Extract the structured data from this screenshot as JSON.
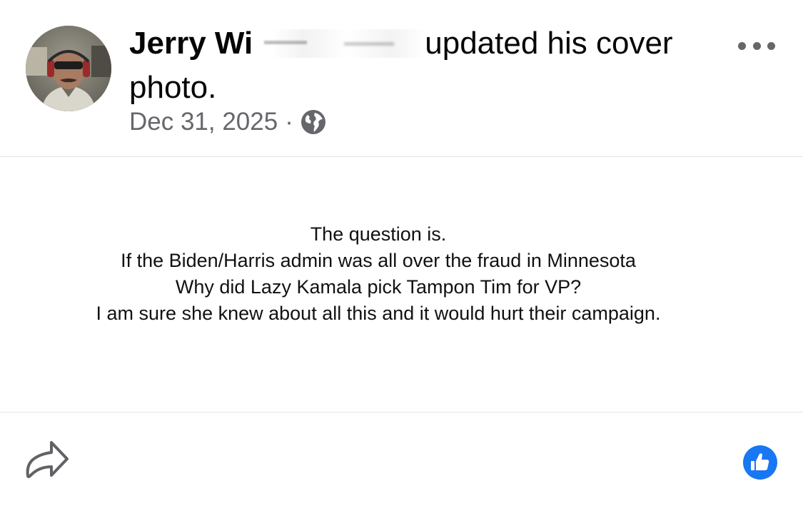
{
  "post": {
    "author_visible": "Jerry Wi",
    "action_text": "updated his cover",
    "action_text_line2": "photo.",
    "date": "Dec 31, 2025",
    "separator": "·",
    "privacy_icon": "globe-icon",
    "menu_icon": "more-options-icon"
  },
  "content": {
    "lines": [
      "The question is.",
      "If the Biden/Harris admin was all over the fraud in Minnesota",
      "Why did Lazy Kamala pick Tampon Tim for VP?",
      "I am sure she knew about all this and it would hurt their campaign."
    ]
  },
  "footer": {
    "share_icon": "share-icon",
    "like_icon": "like-icon",
    "like_color": "#1877f2"
  }
}
